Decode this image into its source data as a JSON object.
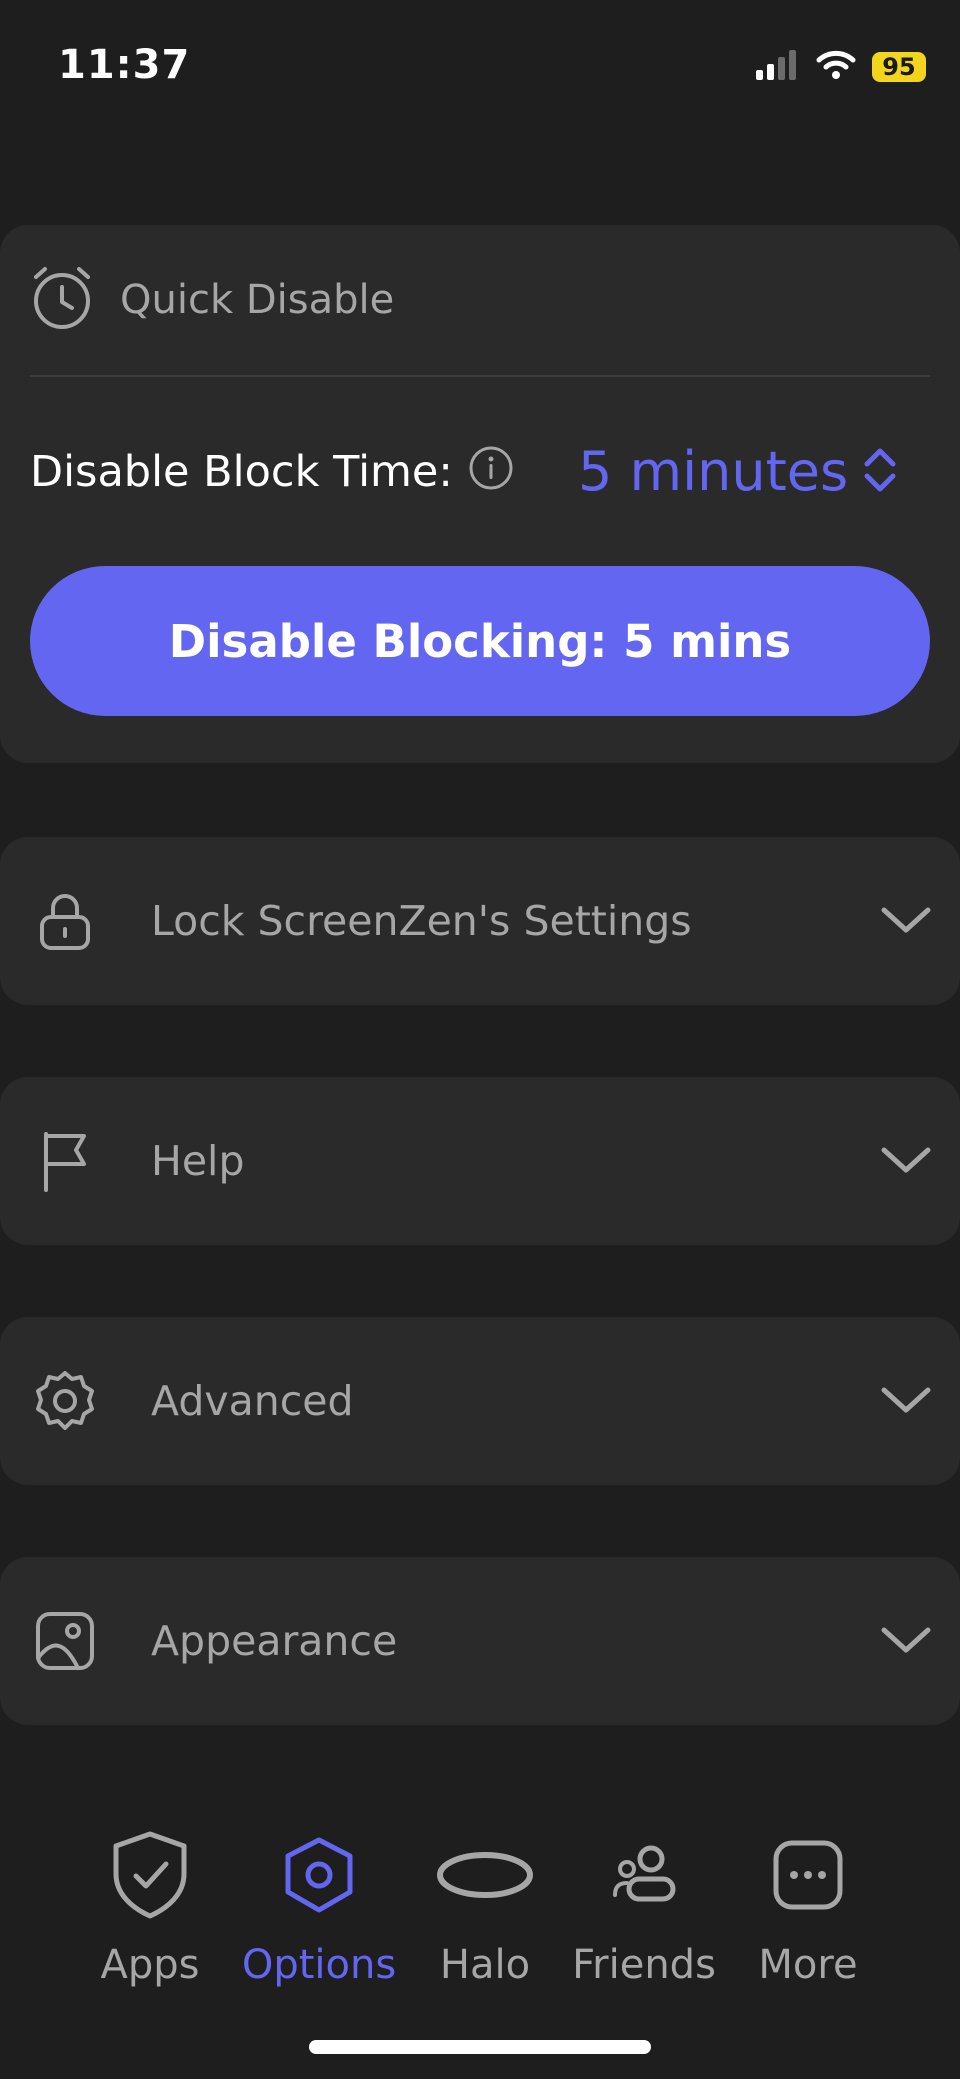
{
  "status_bar": {
    "time": "11:37",
    "battery": "95"
  },
  "quick_disable": {
    "title": "Quick Disable",
    "block_time_label": "Disable Block Time:",
    "block_time_value": "5 minutes",
    "button_label": "Disable Blocking: 5 mins"
  },
  "sections": {
    "lock": "Lock ScreenZen's Settings",
    "help": "Help",
    "advanced": "Advanced",
    "appearance": "Appearance"
  },
  "tabs": {
    "apps": "Apps",
    "options": "Options",
    "halo": "Halo",
    "friends": "Friends",
    "more": "More"
  },
  "colors": {
    "accent": "#6366f1",
    "background": "#1e1e1f",
    "card": "#2a2a2b",
    "muted_text": "#a6a6a6",
    "battery": "#f2d51c"
  },
  "icons": {
    "quick_disable": "alarm-clock-icon",
    "info": "info-icon",
    "picker": "up-down-chevron-icon",
    "lock": "lock-icon",
    "help": "flag-icon",
    "advanced": "gear-icon",
    "appearance": "image-icon",
    "section_toggle": "chevron-down-icon",
    "apps": "shield-check-icon",
    "options": "hexagon-settings-icon",
    "halo": "halo-ring-icon",
    "friends": "friends-icon",
    "more": "more-dots-icon"
  }
}
